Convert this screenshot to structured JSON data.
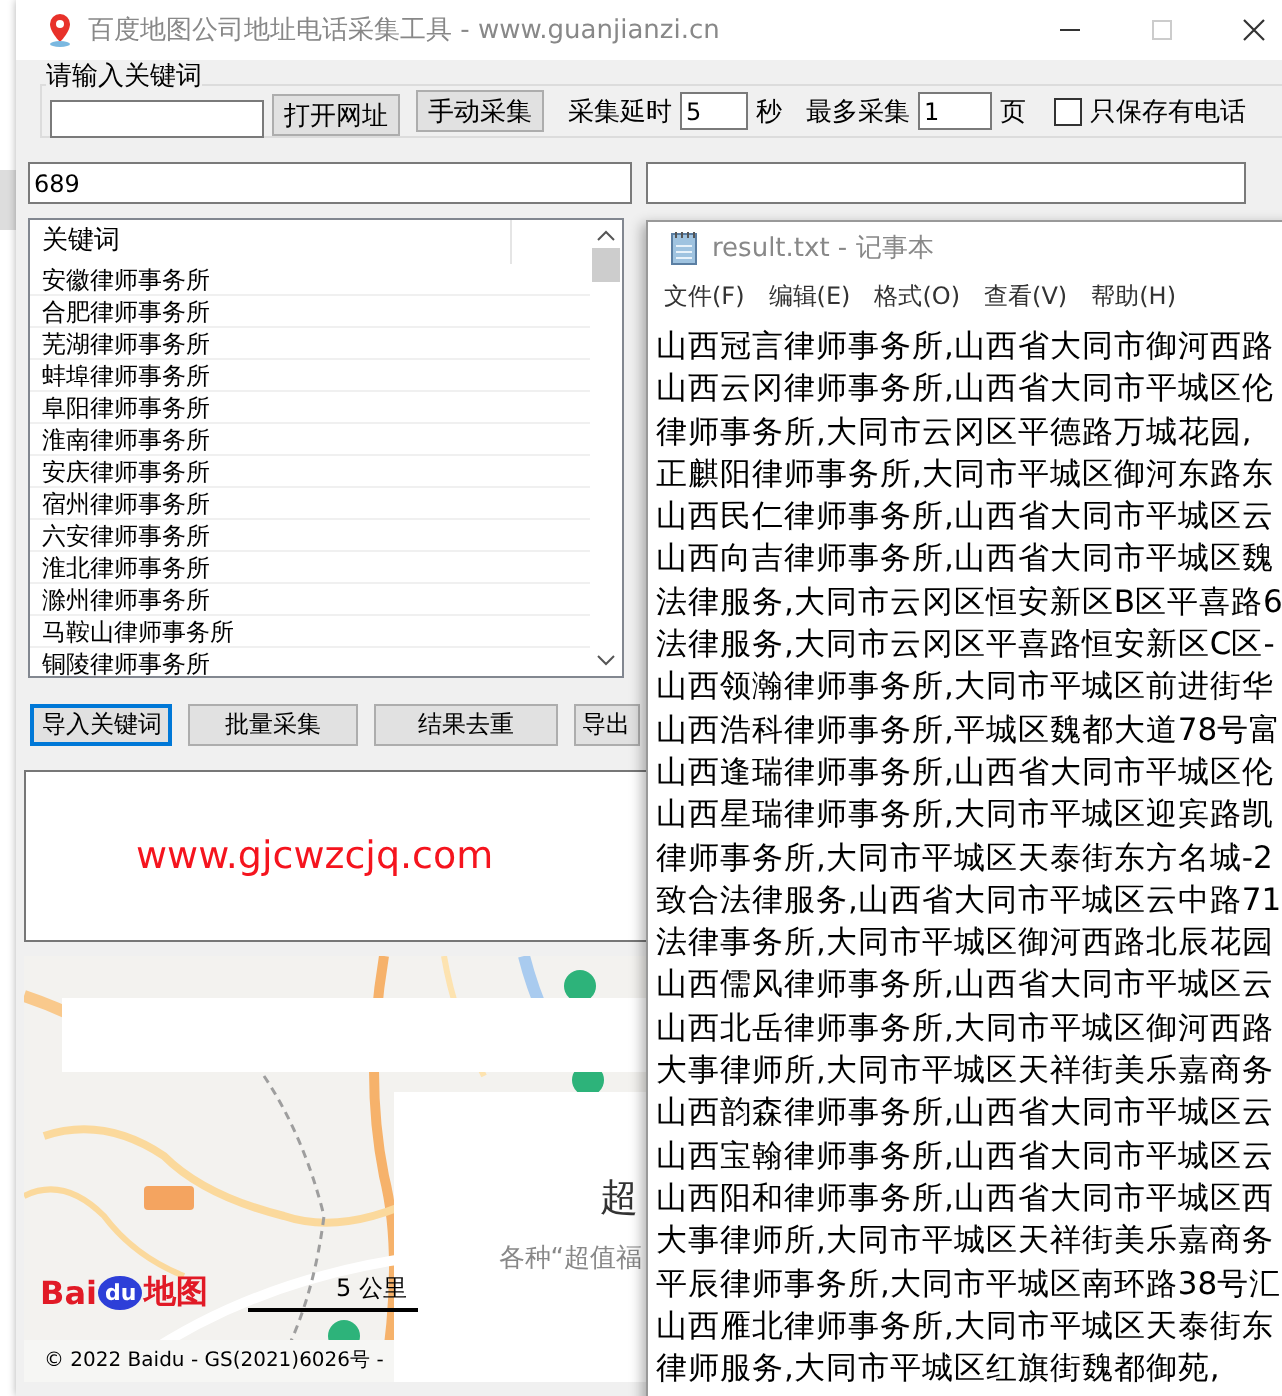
{
  "window": {
    "title": "百度地图公司地址电话采集工具 - www.guanjianzi.cn"
  },
  "keyword_group": {
    "label": "请输入关键词",
    "open_url_button": "打开网址",
    "manual_button": "手动采集",
    "delay": {
      "label": "采集延时",
      "value": "5",
      "unit": "秒"
    },
    "max_pages": {
      "label": "最多采集",
      "value": "1",
      "unit": "页"
    },
    "phone_only": {
      "label": "只保存有电话",
      "checked": false
    }
  },
  "count_field": {
    "value": "689"
  },
  "keyword_list": {
    "column": "关键词",
    "rows": [
      "安徽律师事务所",
      "合肥律师事务所",
      "芜湖律师事务所",
      "蚌埠律师事务所",
      "阜阳律师事务所",
      "淮南律师事务所",
      "安庆律师事务所",
      "宿州律师事务所",
      "六安律师事务所",
      "淮北律师事务所",
      "滁州律师事务所",
      "马鞍山律师事务所",
      "铜陵律师事务所"
    ]
  },
  "buttons": [
    {
      "label": "导入关键词",
      "focused": true
    },
    {
      "label": "批量采集",
      "focused": false
    },
    {
      "label": "结果去重",
      "focused": false
    },
    {
      "label": "导出",
      "focused": false
    }
  ],
  "web_panel": {
    "link": "www.gjcwzcjq.com"
  },
  "map": {
    "kind": "picture",
    "popup": {
      "title": "超",
      "subtitle": "各种“超值福"
    },
    "logo": [
      "Bai",
      "du",
      "地图"
    ],
    "scale": "5 公里",
    "copyright": "© 2022 Baidu - GS(2021)6026号 -"
  },
  "notepad": {
    "title": "result.txt - 记事本",
    "menu": [
      "文件(F)",
      "编辑(E)",
      "格式(O)",
      "查看(V)",
      "帮助(H)"
    ],
    "lines": [
      "山西冠言律师事务所,山西省大同市御河西路",
      "山西云冈律师事务所,山西省大同市平城区伦",
      "律师事务所,大同市云冈区平德路万城花园,",
      "正麒阳律师事务所,大同市平城区御河东路东",
      "山西民仁律师事务所,山西省大同市平城区云",
      "山西向吉律师事务所,山西省大同市平城区魏",
      "法律服务,大同市云冈区恒安新区B区平喜路6",
      "法律服务,大同市云冈区平喜路恒安新区C区-",
      "山西领瀚律师事务所,大同市平城区前进街华",
      "山西浩科律师事务所,平城区魏都大道78号富",
      "山西逢瑞律师事务所,山西省大同市平城区伦",
      "山西星瑞律师事务所,大同市平城区迎宾路凯",
      "律师事务所,大同市平城区天泰街东方名城-2",
      "致合法律服务,山西省大同市平城区云中路71",
      "法律事务所,大同市平城区御河西路北辰花园",
      "山西儒风律师事务所,山西省大同市平城区云",
      "山西北岳律师事务所,大同市平城区御河西路",
      "大事律师所,大同市平城区天祥街美乐嘉商务",
      "山西韵森律师事务所,山西省大同市平城区云",
      "山西宝翰律师事务所,山西省大同市平城区云",
      "山西阳和律师事务所,山西省大同市平城区西",
      "大事律师所,大同市平城区天祥街美乐嘉商务",
      "平辰律师事务所,大同市平城区南环路38号汇",
      "山西雁北律师事务所,大同市平城区天泰街东",
      "律师服务,大同市平城区红旗街魏都御苑,"
    ]
  }
}
